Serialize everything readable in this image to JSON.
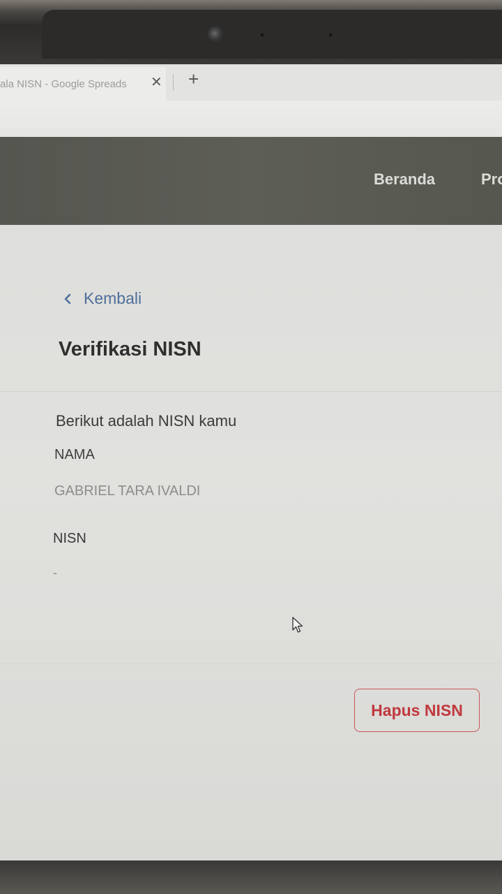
{
  "browser": {
    "tab_title": "ala NISN - Google Spreads",
    "tab_close_glyph": "✕",
    "new_tab_glyph": "+"
  },
  "header": {
    "nav": {
      "beranda": "Beranda",
      "profil": "Pro"
    }
  },
  "main": {
    "back_label": "Kembali",
    "title": "Verifikasi NISN",
    "intro": "Berikut adalah NISN kamu",
    "nama_label": "NAMA",
    "nama_value": "GABRIEL TARA IVALDI",
    "nisn_label": "NISN",
    "nisn_value": "-",
    "delete_button": "Hapus NISN"
  },
  "colors": {
    "header_bg": "#5a5b53",
    "link": "#4f6f9a",
    "danger": "#c0393e"
  },
  "icons": {
    "back": "chevron-left-icon",
    "close": "close-icon",
    "new_tab": "plus-icon",
    "cursor": "mouse-pointer-icon"
  }
}
